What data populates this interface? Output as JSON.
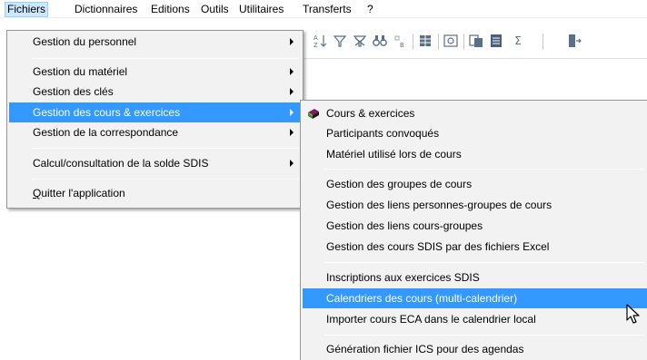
{
  "menubar": {
    "items": [
      {
        "label": "Fichiers",
        "active": true
      },
      {
        "label": "Dictionnaires"
      },
      {
        "label": "Editions"
      },
      {
        "label": "Outils"
      },
      {
        "label": "Utilitaires"
      },
      {
        "label": "Transferts"
      },
      {
        "label": "?"
      }
    ]
  },
  "toolbar": {
    "icons": [
      "sort-az-icon",
      "filter-icon",
      "clear-filter-icon",
      "find-icon",
      "replace-icon",
      "table-view-icon",
      "print-preview-icon",
      "copy-icon",
      "export-icon",
      "sum-icon",
      "exit-icon"
    ],
    "sum_glyph": "Σ"
  },
  "fichiers_menu": {
    "items": [
      {
        "label": "Gestion du personnel",
        "submenu": true
      },
      {
        "label": "Gestion du matériel",
        "submenu": true
      },
      {
        "label": "Gestion des clés",
        "submenu": true
      },
      {
        "label": "Gestion des cours & exercices",
        "submenu": true,
        "highlighted": true
      },
      {
        "label": "Gestion de la correspondance",
        "submenu": true
      },
      {
        "label": "Calcul/consultation de la solde SDIS",
        "submenu": true
      },
      {
        "label_underlined": "Q",
        "label_rest": "uitter l'application"
      }
    ]
  },
  "cours_submenu": {
    "items": [
      {
        "label": "Cours & exercices",
        "icon": "books-icon"
      },
      {
        "label": "Participants  convoqués"
      },
      {
        "label": "Matériel utilisé lors de cours"
      },
      {
        "label": "Gestion des groupes de cours"
      },
      {
        "label": "Gestion des liens personnes-groupes de cours"
      },
      {
        "label": "Gestion des liens cours-groupes"
      },
      {
        "label": "Gestion des cours SDIS par des fichiers Excel"
      },
      {
        "label": "Inscriptions aux exercices SDIS"
      },
      {
        "label": "Calendriers des cours (multi-calendrier)",
        "highlighted": true
      },
      {
        "label": "Importer cours ECA dans le calendrier local"
      },
      {
        "label": "Génération fichier ICS pour des agendas"
      }
    ]
  },
  "colors": {
    "highlight": "#3399ff",
    "menu_background": "#f2f2f2",
    "menubar_active": "#cce8ff"
  }
}
